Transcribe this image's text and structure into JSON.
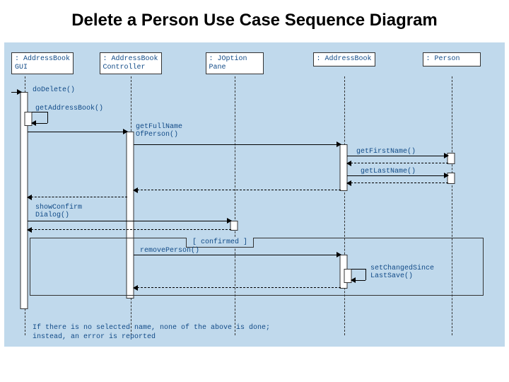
{
  "title": "Delete a Person Use Case Sequence Diagram",
  "lifelines": {
    "gui": ": AddressBook\nGUI",
    "controller": ": AddressBook\nController",
    "jopt": ": JOption\nPane",
    "book": ": AddressBook",
    "person": ": Person"
  },
  "messages": {
    "doDelete": "doDelete()",
    "getAddressBook": "getAddressBook()",
    "getFullName": "getFullName\nOfPerson()",
    "getFirstName": "getFirstName()",
    "getLastName": "getLastName()",
    "showConfirm": "showConfirm\nDialog()",
    "removePerson": "removePerson()",
    "setChanged": "setChangedSince\nLastSave()"
  },
  "frame": {
    "guard": "[ confirmed ]"
  },
  "footnote": "If there is no selected name, none of the above is done;\ninstead, an error is reported"
}
